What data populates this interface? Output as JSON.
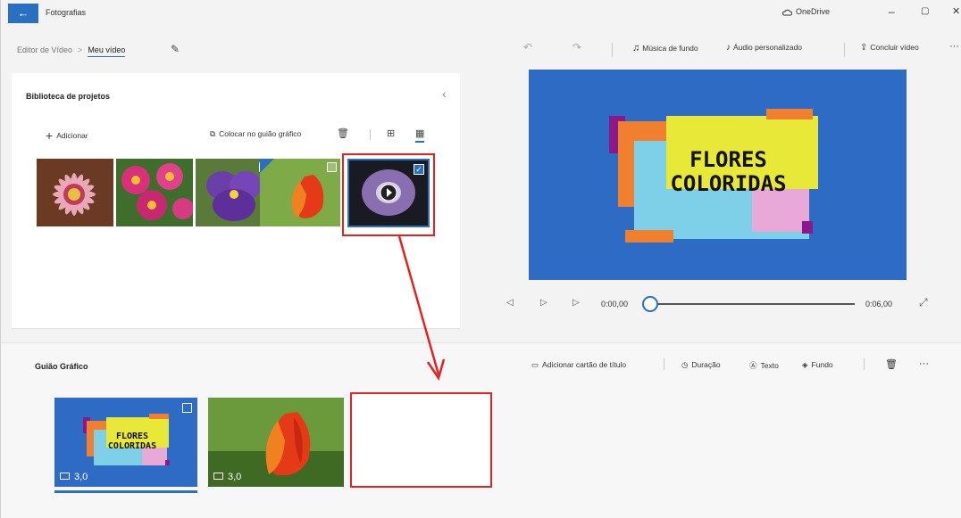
{
  "titlebar": {
    "back_icon": "arrow-left-icon",
    "app_title": "Fotografias",
    "onedrive_label": "OneDrive",
    "minimize": "–",
    "maximize": "▢",
    "close": "✕"
  },
  "breadcrumb": {
    "parent": "Editor de Vídeo",
    "separator": ">",
    "current": "Meu vídeo"
  },
  "toolbar": {
    "background_music": "Música de fundo",
    "custom_audio": "Áudio personalizado",
    "finish_video": "Concluir vídeo",
    "more": "···"
  },
  "library": {
    "title": "Biblioteca de projetos",
    "add_label": "Adicionar",
    "place_label": "Colocar no guião gráfico"
  },
  "preview": {
    "title_line1": "FLORES",
    "title_line2": "COLORIDAS",
    "time_current": "0:00,00",
    "time_total": "0:06,00"
  },
  "storyboard": {
    "title": "Guião Gráfico",
    "add_title_card": "Adicionar cartão de título",
    "duration": "Duração",
    "text": "Texto",
    "background": "Fundo",
    "more": "···",
    "cards": [
      {
        "line1": "FLORES",
        "line2": "COLORIDAS",
        "duration": "3,0"
      },
      {
        "duration": "3,0"
      }
    ]
  },
  "colors": {
    "accent": "#2b6fc1",
    "annotation_red": "#e02424",
    "preview_bg": "#2e6bc4"
  }
}
